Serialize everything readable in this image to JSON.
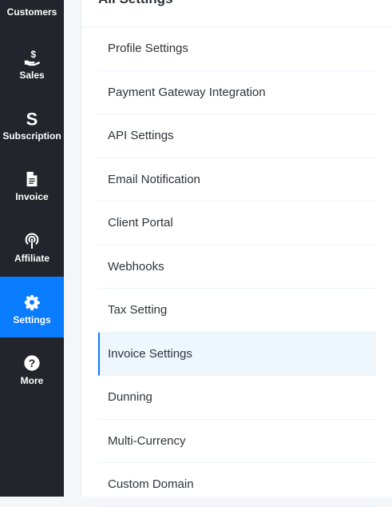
{
  "sidebar": {
    "items": [
      {
        "label": "Customers",
        "icon": "customers-icon"
      },
      {
        "label": "Sales",
        "icon": "hand-dollar-icon"
      },
      {
        "label": "Subscription",
        "icon": "subscription-s-icon"
      },
      {
        "label": "Invoice",
        "icon": "document-icon"
      },
      {
        "label": "Affiliate",
        "icon": "broadcast-icon"
      },
      {
        "label": "Settings",
        "icon": "gear-icon",
        "active": true
      },
      {
        "label": "More",
        "icon": "question-circle-icon"
      }
    ],
    "active_color": "#0a7cff",
    "background": "#22252b"
  },
  "panel": {
    "title": "All Settings",
    "items": [
      {
        "label": "Profile Settings"
      },
      {
        "label": "Payment Gateway Integration"
      },
      {
        "label": "API Settings"
      },
      {
        "label": "Email Notification"
      },
      {
        "label": "Client Portal"
      },
      {
        "label": "Webhooks"
      },
      {
        "label": "Tax Setting"
      },
      {
        "label": "Invoice Settings",
        "active": true
      },
      {
        "label": "Dunning"
      },
      {
        "label": "Multi-Currency"
      },
      {
        "label": "Custom Domain"
      }
    ]
  }
}
